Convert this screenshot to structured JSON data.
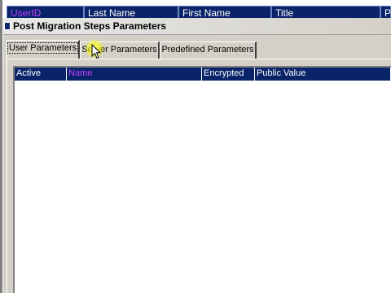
{
  "background_grid": {
    "columns": [
      {
        "label": "UserID"
      },
      {
        "label": "Last Name"
      },
      {
        "label": "First Name"
      },
      {
        "label": "Title"
      },
      {
        "label": "P"
      }
    ]
  },
  "dialog": {
    "title": "Post Migration Steps Parameters",
    "tabs": [
      {
        "label": "User Parameters",
        "active": true
      },
      {
        "label": "Server Parameters",
        "active": false
      },
      {
        "label": "Predefined Parameters",
        "active": false
      }
    ],
    "list": {
      "columns": [
        {
          "label": "Active"
        },
        {
          "label": "Name"
        },
        {
          "label": "Encrypted"
        },
        {
          "label": "Public Value"
        }
      ],
      "rows": []
    }
  },
  "colors": {
    "header_bg": "#0a246a",
    "header_text": "#ffffff",
    "highlight_text": "#c040ff",
    "window_bg": "#d4d0c8"
  },
  "cursor": {
    "icon": "arrow-pointer-icon",
    "highlight": "yellow"
  }
}
